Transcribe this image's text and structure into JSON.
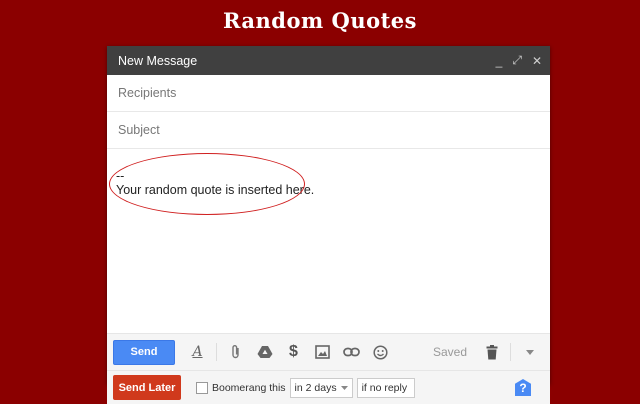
{
  "page": {
    "title": "Random Quotes"
  },
  "compose": {
    "title": "New Message",
    "window_buttons": {
      "minimize": "_",
      "expand": "⤢",
      "close": "✕"
    },
    "recipients_placeholder": "Recipients",
    "subject_placeholder": "Subject",
    "body": {
      "signature_dash": "--",
      "quote_text": "Your random quote is inserted here."
    },
    "toolbar": {
      "send_label": "Send",
      "formatting_glyph": "A",
      "money_glyph": "$",
      "saved_label": "Saved"
    },
    "bottombar": {
      "send_later_label": "Send Later",
      "boomerang_label": "Boomerang this",
      "interval_value": "in 2 days",
      "condition_value": "if no reply",
      "help_glyph": "?"
    }
  },
  "colors": {
    "background": "#8b0000",
    "send": "#4a8af4",
    "send_later": "#d0391c",
    "annotation": "#d02020"
  }
}
